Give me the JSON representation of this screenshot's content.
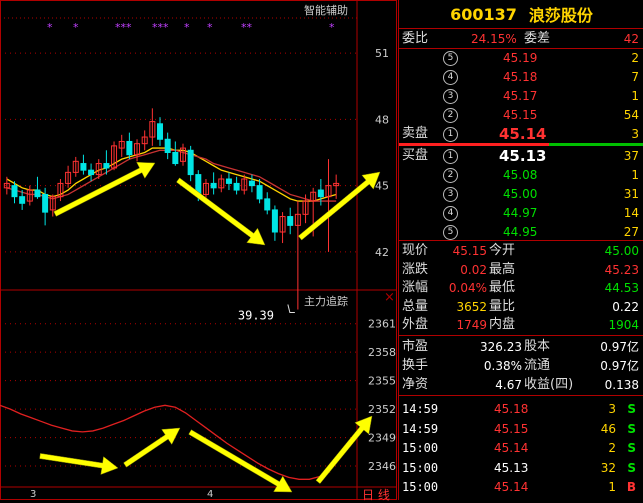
{
  "chart_data": [
    {
      "type": "candlestick",
      "title": "",
      "y_ticks": [
        51,
        48,
        45,
        42
      ],
      "x_ticks": [
        "3",
        "4"
      ],
      "ylim": [
        40.5,
        52.5
      ],
      "candles": [
        {
          "o": 44.9,
          "h": 45.4,
          "l": 44.6,
          "c": 45.1
        },
        {
          "o": 45.0,
          "h": 45.2,
          "l": 44.2,
          "c": 44.5
        },
        {
          "o": 44.5,
          "h": 44.8,
          "l": 43.9,
          "c": 44.2
        },
        {
          "o": 44.3,
          "h": 45.0,
          "l": 44.1,
          "c": 44.8
        },
        {
          "o": 44.8,
          "h": 45.4,
          "l": 44.4,
          "c": 44.5
        },
        {
          "o": 44.6,
          "h": 44.9,
          "l": 43.2,
          "c": 43.8
        },
        {
          "o": 43.9,
          "h": 44.6,
          "l": 43.6,
          "c": 44.5
        },
        {
          "o": 44.5,
          "h": 45.3,
          "l": 44.3,
          "c": 45.1
        },
        {
          "o": 45.1,
          "h": 45.9,
          "l": 44.9,
          "c": 45.6
        },
        {
          "o": 45.6,
          "h": 46.3,
          "l": 45.4,
          "c": 46.1
        },
        {
          "o": 46.0,
          "h": 46.4,
          "l": 45.5,
          "c": 45.7
        },
        {
          "o": 45.7,
          "h": 46.0,
          "l": 45.2,
          "c": 45.5
        },
        {
          "o": 45.5,
          "h": 46.2,
          "l": 45.3,
          "c": 46.0
        },
        {
          "o": 46.0,
          "h": 46.6,
          "l": 45.5,
          "c": 45.8
        },
        {
          "o": 45.8,
          "h": 47.0,
          "l": 45.7,
          "c": 46.8
        },
        {
          "o": 46.7,
          "h": 47.3,
          "l": 46.3,
          "c": 47.0
        },
        {
          "o": 47.0,
          "h": 47.4,
          "l": 46.2,
          "c": 46.4
        },
        {
          "o": 46.4,
          "h": 47.1,
          "l": 46.1,
          "c": 46.9
        },
        {
          "o": 46.9,
          "h": 47.5,
          "l": 46.6,
          "c": 47.2
        },
        {
          "o": 47.2,
          "h": 48.5,
          "l": 46.8,
          "c": 47.9
        },
        {
          "o": 47.8,
          "h": 48.1,
          "l": 46.8,
          "c": 47.1
        },
        {
          "o": 47.1,
          "h": 47.4,
          "l": 46.2,
          "c": 46.5
        },
        {
          "o": 46.5,
          "h": 47.0,
          "l": 45.9,
          "c": 46.0
        },
        {
          "o": 46.1,
          "h": 46.9,
          "l": 45.9,
          "c": 46.7
        },
        {
          "o": 46.6,
          "h": 46.8,
          "l": 45.2,
          "c": 45.5
        },
        {
          "o": 45.5,
          "h": 45.7,
          "l": 44.3,
          "c": 44.6
        },
        {
          "o": 44.6,
          "h": 45.3,
          "l": 44.4,
          "c": 45.1
        },
        {
          "o": 45.1,
          "h": 45.6,
          "l": 44.6,
          "c": 44.9
        },
        {
          "o": 44.9,
          "h": 45.5,
          "l": 44.7,
          "c": 45.3
        },
        {
          "o": 45.3,
          "h": 45.6,
          "l": 44.8,
          "c": 45.1
        },
        {
          "o": 45.1,
          "h": 45.4,
          "l": 44.6,
          "c": 44.8
        },
        {
          "o": 44.8,
          "h": 45.5,
          "l": 44.6,
          "c": 45.3
        },
        {
          "o": 45.2,
          "h": 45.5,
          "l": 44.7,
          "c": 45.0
        },
        {
          "o": 45.0,
          "h": 45.3,
          "l": 44.2,
          "c": 44.4
        },
        {
          "o": 44.4,
          "h": 44.7,
          "l": 43.7,
          "c": 43.9
        },
        {
          "o": 43.9,
          "h": 44.1,
          "l": 42.5,
          "c": 42.9
        },
        {
          "o": 42.9,
          "h": 43.8,
          "l": 42.4,
          "c": 43.6
        },
        {
          "o": 43.6,
          "h": 44.0,
          "l": 42.8,
          "c": 43.2
        },
        {
          "o": 43.2,
          "h": 44.3,
          "l": 39.39,
          "c": 43.7
        },
        {
          "o": 43.7,
          "h": 44.6,
          "l": 43.3,
          "c": 44.3
        },
        {
          "o": 44.3,
          "h": 44.9,
          "l": 42.7,
          "c": 44.7
        },
        {
          "o": 44.8,
          "h": 45.3,
          "l": 44.1,
          "c": 44.5
        },
        {
          "o": 44.5,
          "h": 46.2,
          "l": 42.0,
          "c": 45.0
        },
        {
          "o": 45.0,
          "h": 45.5,
          "l": 44.4,
          "c": 45.1
        }
      ],
      "series": [
        {
          "values": [
            45.3,
            45.1,
            44.9,
            44.8,
            44.8,
            44.6,
            44.5,
            44.6,
            44.8,
            45.1,
            45.3,
            45.5,
            45.7,
            45.8,
            46.0,
            46.2,
            46.3,
            46.4,
            46.5,
            46.7,
            46.7,
            46.7,
            46.6,
            46.6,
            46.5,
            46.3,
            46.1,
            45.9,
            45.7,
            45.6,
            45.5,
            45.4,
            45.3,
            45.2,
            45.0,
            44.8,
            44.6,
            44.4,
            44.3,
            44.3,
            44.3,
            44.4,
            44.5,
            44.6
          ],
          "color": "#ffd400"
        },
        {
          "values": [
            44.9,
            44.8,
            44.7,
            44.6,
            44.6,
            44.5,
            44.4,
            44.5,
            44.6,
            44.8,
            45.0,
            45.2,
            45.4,
            45.6,
            45.8,
            46.0,
            46.2,
            46.3,
            46.4,
            46.5,
            46.6,
            46.6,
            46.6,
            46.5,
            46.4,
            46.3,
            46.2,
            46.0,
            45.9,
            45.8,
            45.7,
            45.6,
            45.5,
            45.4,
            45.2,
            45.0,
            44.8,
            44.6,
            44.5,
            44.4,
            44.3,
            44.3,
            44.3,
            44.3
          ],
          "color": "#c83232"
        }
      ],
      "annotations": [
        {
          "text": "39.39",
          "candle_index": 38
        }
      ],
      "signal_markers": [
        "*",
        "*",
        "***",
        "***",
        "*",
        "*",
        "**",
        "*"
      ]
    },
    {
      "type": "line",
      "title": "",
      "y_ticks": [
        2361,
        2358,
        2355,
        2352,
        2349,
        2346
      ],
      "ylim": [
        2344,
        2363.5
      ],
      "series": [
        {
          "values": [
            2352.4,
            2352.0,
            2351.5,
            2351.1,
            2350.7,
            2350.3,
            2350.0,
            2349.7,
            2349.6,
            2349.7,
            2350.0,
            2350.4,
            2350.8,
            2351.3,
            2351.8,
            2352.2,
            2352.4,
            2352.2,
            2351.6,
            2350.8,
            2350.0,
            2349.2,
            2348.4,
            2347.7,
            2347.0,
            2346.3,
            2345.7,
            2345.2,
            2344.8,
            2344.6,
            2344.6,
            2344.9,
            2345.4
          ],
          "color": "#e02020"
        }
      ]
    }
  ],
  "chart_labels": {
    "assist": "智能辅助",
    "mainforce": "主力追踪",
    "low_label": "39.39",
    "period_label": "日 线",
    "close_mark": "×"
  },
  "quote": {
    "code": "600137",
    "name": "浪莎股份",
    "weibi_label": "委比",
    "weibi_value": "24.15%",
    "weicha_label": "委差",
    "weicha_value": "42",
    "sell_label": "卖盘",
    "buy_label": "买盘",
    "asks": [
      {
        "n": "⑤",
        "price": "45.19",
        "vol": "2"
      },
      {
        "n": "④",
        "price": "45.18",
        "vol": "7"
      },
      {
        "n": "③",
        "price": "45.17",
        "vol": "1"
      },
      {
        "n": "②",
        "price": "45.15",
        "vol": "54"
      },
      {
        "n": "①",
        "price": "45.14",
        "vol": "3"
      }
    ],
    "bids": [
      {
        "n": "①",
        "price": "45.13",
        "vol": "37"
      },
      {
        "n": "②",
        "price": "45.08",
        "vol": "1"
      },
      {
        "n": "③",
        "price": "45.00",
        "vol": "31"
      },
      {
        "n": "④",
        "price": "44.97",
        "vol": "14"
      },
      {
        "n": "⑤",
        "price": "44.95",
        "vol": "27"
      }
    ],
    "stats1": [
      {
        "l1": "现价",
        "v1": "45.15",
        "c1": "r",
        "l2": "今开",
        "v2": "45.00",
        "c2": "g"
      },
      {
        "l1": "涨跌",
        "v1": "0.02",
        "c1": "r",
        "l2": "最高",
        "v2": "45.23",
        "c2": "r"
      },
      {
        "l1": "涨幅",
        "v1": "0.04%",
        "c1": "r",
        "l2": "最低",
        "v2": "44.53",
        "c2": "g"
      },
      {
        "l1": "总量",
        "v1": "3652",
        "c1": "y",
        "l2": "量比",
        "v2": "0.22",
        "c2": "w"
      },
      {
        "l1": "外盘",
        "v1": "1749",
        "c1": "r",
        "l2": "内盘",
        "v2": "1904",
        "c2": "g"
      }
    ],
    "stats2": [
      {
        "l1": "市盈",
        "v1": "326.23",
        "c1": "w",
        "l2": "股本",
        "v2": "0.97亿",
        "c2": "w"
      },
      {
        "l1": "换手",
        "v1": "0.38%",
        "c1": "w",
        "l2": "流通",
        "v2": "0.97亿",
        "c2": "w"
      },
      {
        "l1": "净资",
        "v1": "4.67",
        "c1": "w",
        "l2": "收益(四)",
        "v2": "0.138",
        "c2": "w"
      }
    ],
    "ticks": [
      {
        "t": "14:59",
        "p": "45.18",
        "pc": "r",
        "v": "3",
        "vc": "y",
        "s": "S",
        "sc": "g"
      },
      {
        "t": "14:59",
        "p": "45.15",
        "pc": "r",
        "v": "46",
        "vc": "y",
        "s": "S",
        "sc": "g"
      },
      {
        "t": "15:00",
        "p": "45.14",
        "pc": "r",
        "v": "2",
        "vc": "y",
        "s": "S",
        "sc": "g"
      },
      {
        "t": "15:00",
        "p": "45.13",
        "pc": "w",
        "v": "32",
        "vc": "y",
        "s": "S",
        "sc": "g"
      },
      {
        "t": "15:00",
        "p": "45.14",
        "pc": "r",
        "v": "1",
        "vc": "y",
        "s": "B",
        "sc": "r"
      }
    ]
  },
  "colors": {
    "up": "#ff3232",
    "down": "#00e5e5",
    "grid": "#b00000",
    "arrow": "#ffff00",
    "accent": "#ffd400"
  }
}
